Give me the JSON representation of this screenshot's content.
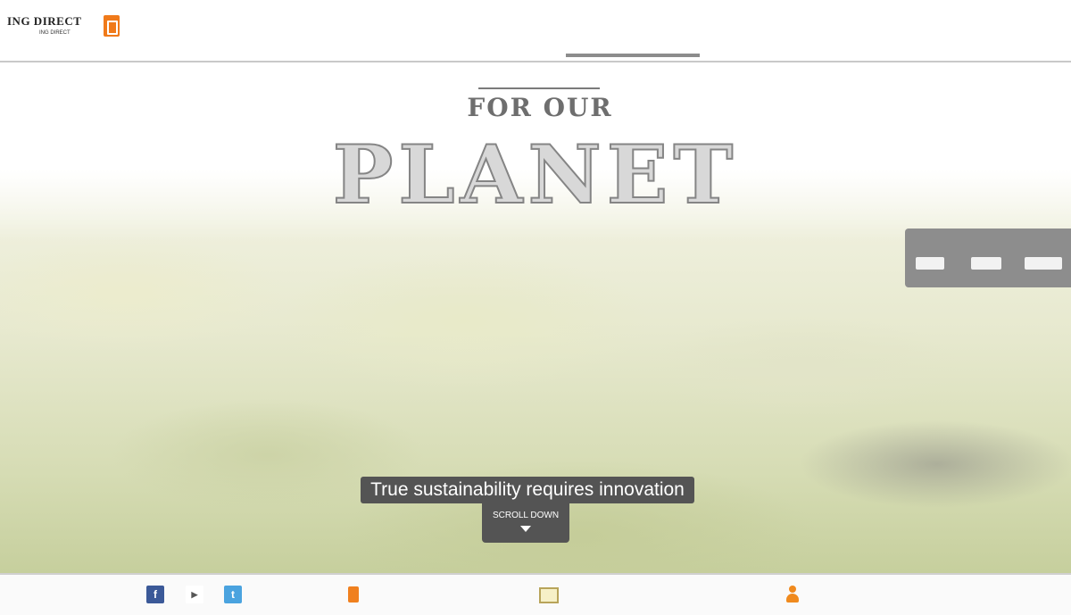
{
  "header": {
    "logo_text": "ING DIRECT",
    "logo_subtext": "ING DIRECT",
    "nav": [
      {
        "label": "",
        "sub": ""
      },
      {
        "label": "",
        "sub": ""
      },
      {
        "label": "",
        "sub": ""
      },
      {
        "label": "",
        "sub": ""
      },
      {
        "label": "",
        "sub": ""
      },
      {
        "label": "",
        "sub": ""
      }
    ]
  },
  "hero": {
    "title_small": "FOR OUR",
    "title_big": "PLANET",
    "caption": "True sustainability requires innovation",
    "scroll_label": "SCROLL DOWN"
  },
  "share": {
    "label_left": "",
    "label_right": "",
    "buttons": [
      "",
      "",
      ""
    ]
  },
  "footer": {
    "items": [
      "",
      "",
      "",
      "",
      ""
    ]
  },
  "colors": {
    "accent": "#f07a1a",
    "facebook": "#3b5998",
    "twitter": "#4aa3df",
    "caption_bg": "#545454",
    "share_bg": "#8d8d8d"
  },
  "icons": [
    "logo-mark-icon",
    "facebook-icon",
    "youtube-icon",
    "twitter-icon",
    "mail-icon",
    "user-icon",
    "arrow-down-icon"
  ]
}
